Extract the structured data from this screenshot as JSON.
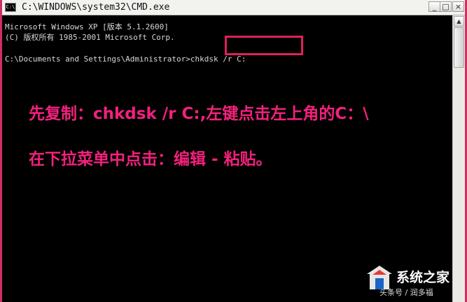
{
  "window": {
    "title": "C:\\WINDOWS\\system32\\CMD.exe",
    "app_icon_text": "C:\\",
    "minimize_glyph": "_",
    "maximize_glyph": "□",
    "close_glyph": "×"
  },
  "console": {
    "lines": [
      "Microsoft Windows XP [版本 5.1.2600]",
      "(C) 版权所有 1985-2001 Microsoft Corp.",
      "",
      "C:\\Documents and Settings\\Administrator>chkdsk /r C:"
    ],
    "highlighted_command": "chkdsk /r C:"
  },
  "annotation": {
    "line1": "先复制：chkdsk /r C:,左键点击左上角的C：\\",
    "line2": "在下拉菜单中点击：编辑 - 粘贴。",
    "color": "#f2217c"
  },
  "watermark": {
    "brand": "系统之家",
    "sub": "头条号 / 润多福"
  },
  "colors": {
    "border": "#cf2f62",
    "console_bg": "#000000",
    "console_text": "#d8d8d8",
    "highlight_box": "#e0205a"
  }
}
